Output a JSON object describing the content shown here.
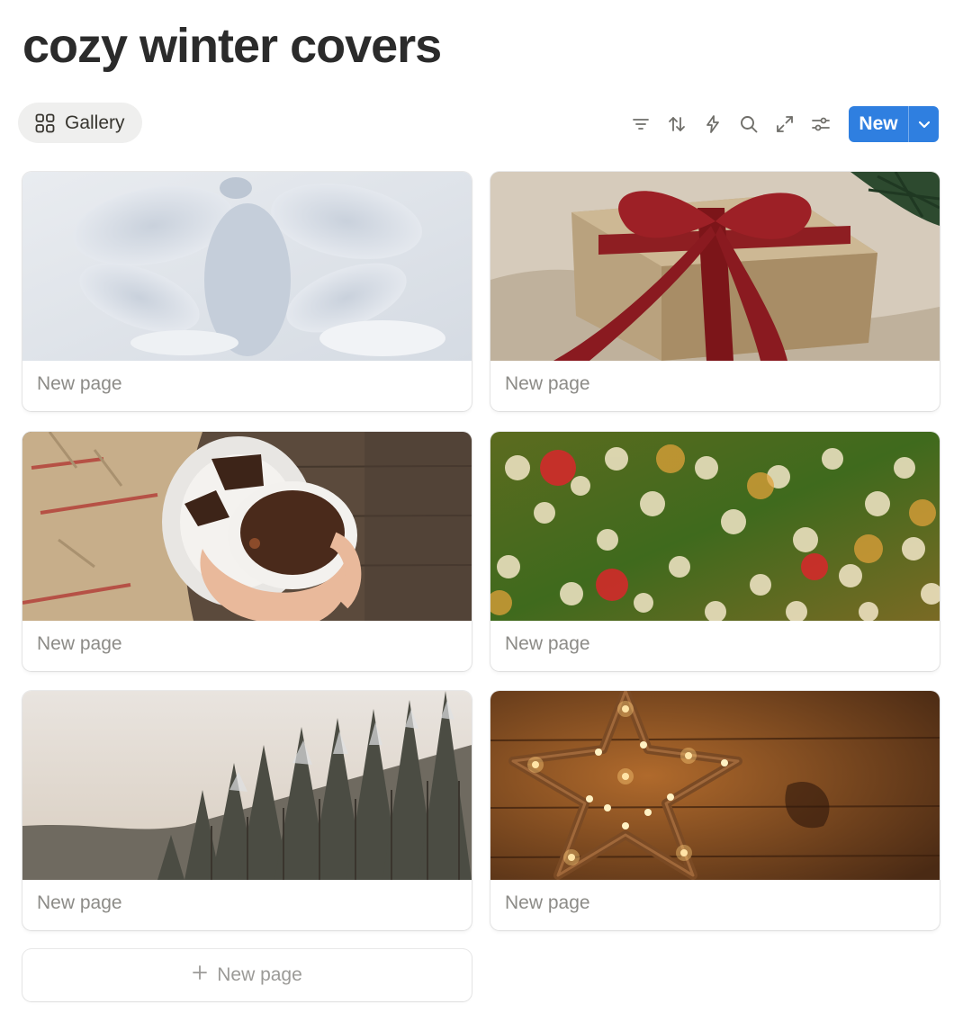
{
  "page": {
    "title": "cozy winter covers"
  },
  "view_tab": {
    "icon": "gallery-grid-icon",
    "label": "Gallery"
  },
  "toolbar": {
    "tools": [
      "filter-icon",
      "sort-icon",
      "automation-bolt-icon",
      "search-icon",
      "expand-icon",
      "settings-sliders-icon"
    ],
    "new_label": "New",
    "new_menu_icon": "chevron-down-icon"
  },
  "cards": [
    {
      "label": "New page",
      "cover": "snow angel in snow"
    },
    {
      "label": "New page",
      "cover": "gift box with red ribbon"
    },
    {
      "label": "New page",
      "cover": "hot chocolate mug with blanket"
    },
    {
      "label": "New page",
      "cover": "bokeh christmas lights"
    },
    {
      "label": "New page",
      "cover": "snowy pine forest"
    },
    {
      "label": "New page",
      "cover": "star of lights on wood"
    }
  ],
  "add_card": {
    "icon": "plus-icon",
    "label": "New page"
  },
  "colors": {
    "accent": "#2f7fe0",
    "text": "#37352f",
    "muted": "#8c8b87",
    "tab_bg": "#efefee"
  }
}
